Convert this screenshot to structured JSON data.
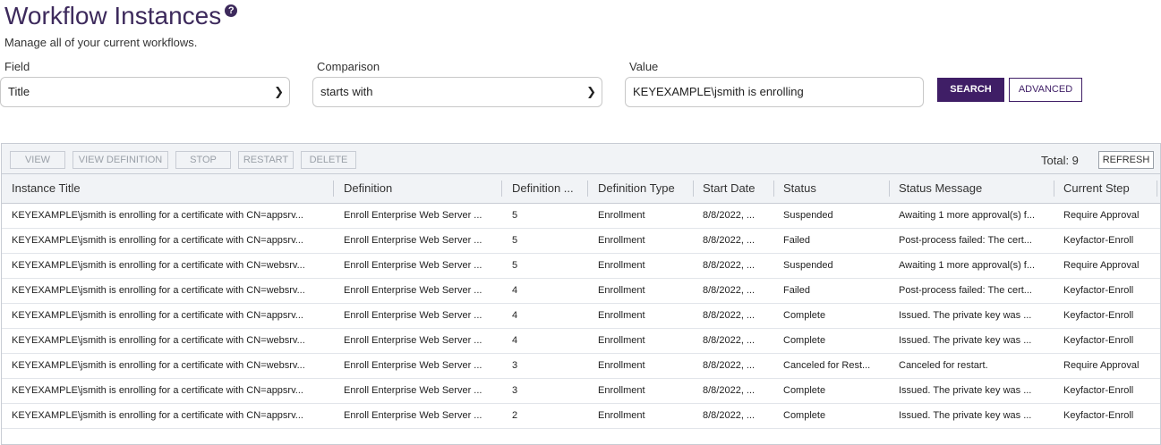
{
  "page": {
    "title": "Workflow Instances",
    "help_glyph": "?",
    "subtitle": "Manage all of your current workflows."
  },
  "search": {
    "field_label": "Field",
    "field_value": "Title",
    "comparison_label": "Comparison",
    "comparison_value": "starts with",
    "value_label": "Value",
    "value_text": "KEYEXAMPLE\\jsmith is enrolling",
    "search_button": "SEARCH",
    "advanced_button": "ADVANCED"
  },
  "toolbar": {
    "view": "VIEW",
    "view_definition": "VIEW DEFINITION",
    "stop": "STOP",
    "restart": "RESTART",
    "delete": "DELETE",
    "total": "Total: 9",
    "refresh": "REFRESH"
  },
  "table": {
    "columns": [
      "Instance Title",
      "Definition",
      "Definition ...",
      "Definition Type",
      "Start Date",
      "Status",
      "Status Message",
      "Current Step"
    ],
    "rows": [
      [
        "KEYEXAMPLE\\jsmith is enrolling for a certificate with CN=appsrv...",
        "Enroll Enterprise Web Server ...",
        "5",
        "Enrollment",
        "8/8/2022, ...",
        "Suspended",
        "Awaiting 1 more approval(s) f...",
        "Require Approval"
      ],
      [
        "KEYEXAMPLE\\jsmith is enrolling for a certificate with CN=appsrv...",
        "Enroll Enterprise Web Server ...",
        "5",
        "Enrollment",
        "8/8/2022, ...",
        "Failed",
        "Post-process failed: The cert...",
        "Keyfactor-Enroll"
      ],
      [
        "KEYEXAMPLE\\jsmith is enrolling for a certificate with CN=websrv...",
        "Enroll Enterprise Web Server ...",
        "5",
        "Enrollment",
        "8/8/2022, ...",
        "Suspended",
        "Awaiting 1 more approval(s) f...",
        "Require Approval"
      ],
      [
        "KEYEXAMPLE\\jsmith is enrolling for a certificate with CN=websrv...",
        "Enroll Enterprise Web Server ...",
        "4",
        "Enrollment",
        "8/8/2022, ...",
        "Failed",
        "Post-process failed: The cert...",
        "Keyfactor-Enroll"
      ],
      [
        "KEYEXAMPLE\\jsmith is enrolling for a certificate with CN=appsrv...",
        "Enroll Enterprise Web Server ...",
        "4",
        "Enrollment",
        "8/8/2022, ...",
        "Complete",
        "Issued. The private key was ...",
        "Keyfactor-Enroll"
      ],
      [
        "KEYEXAMPLE\\jsmith is enrolling for a certificate with CN=websrv...",
        "Enroll Enterprise Web Server ...",
        "4",
        "Enrollment",
        "8/8/2022, ...",
        "Complete",
        "Issued. The private key was ...",
        "Keyfactor-Enroll"
      ],
      [
        "KEYEXAMPLE\\jsmith is enrolling for a certificate with CN=websrv...",
        "Enroll Enterprise Web Server ...",
        "3",
        "Enrollment",
        "8/8/2022, ...",
        "Canceled for Rest...",
        "Canceled for restart.",
        "Require Approval"
      ],
      [
        "KEYEXAMPLE\\jsmith is enrolling for a certificate with CN=appsrv...",
        "Enroll Enterprise Web Server ...",
        "3",
        "Enrollment",
        "8/8/2022, ...",
        "Complete",
        "Issued. The private key was ...",
        "Keyfactor-Enroll"
      ],
      [
        "KEYEXAMPLE\\jsmith is enrolling for a certificate with CN=appsrv...",
        "Enroll Enterprise Web Server ...",
        "2",
        "Enrollment",
        "8/8/2022, ...",
        "Complete",
        "Issued. The private key was ...",
        "Keyfactor-Enroll"
      ]
    ]
  },
  "colors": {
    "brand": "#3f1e66",
    "title": "#3d2a5c",
    "grid_header_bg": "#f1f3f6"
  }
}
